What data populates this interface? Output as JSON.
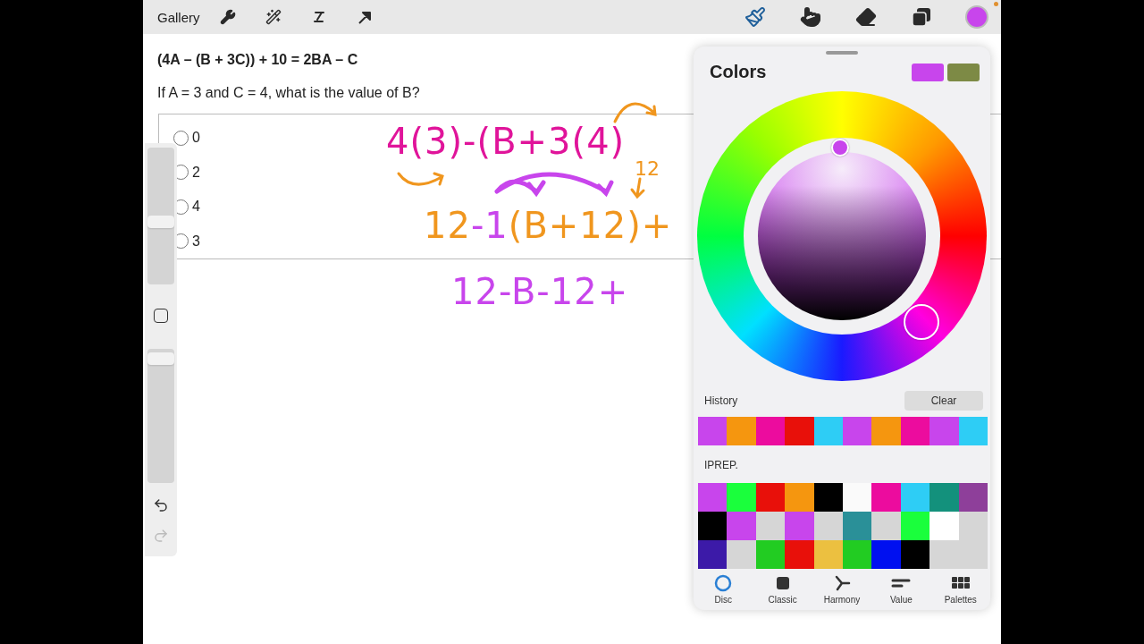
{
  "toolbar": {
    "gallery": "Gallery",
    "tools": [
      {
        "kind": "brush",
        "selected": true
      },
      {
        "kind": "smudge",
        "selected": false
      },
      {
        "kind": "eraser",
        "selected": false
      },
      {
        "kind": "layers",
        "selected": false
      }
    ]
  },
  "document": {
    "formula": "(4A – (B + 3C)) + 10 = 2BA – C",
    "question": "If A = 3 and C = 4, what is the value of B?",
    "options": [
      {
        "label": "0",
        "selected": false
      },
      {
        "label": "2",
        "selected": false
      },
      {
        "label": "4",
        "selected": false
      },
      {
        "label": "3",
        "selected": false
      }
    ]
  },
  "handwriting": [
    {
      "segments": [
        {
          "text": "4(3)-(B+3(4)",
          "color": "#e0149a"
        }
      ]
    },
    {
      "segments": [
        {
          "text": "12",
          "color": "#f0961e"
        },
        {
          "text": "-1",
          "color": "#c845ec"
        },
        {
          "text": "(B+12)+",
          "color": "#f0961e"
        }
      ]
    },
    {
      "segments": [
        {
          "text": "12-B-12+",
          "color": "#c845ec"
        }
      ]
    }
  ],
  "note": {
    "text": "12",
    "color": "#f0961e"
  },
  "sidebar": {
    "size": {
      "level": 0.45
    },
    "opacity": {
      "level": 0.97
    }
  },
  "colors_panel": {
    "title": "Colors",
    "history_label": "History",
    "clear": "Clear",
    "history": [
      {
        "color": "#c845ec"
      },
      {
        "color": "#f5960f"
      },
      {
        "color": "#ec0c9e"
      },
      {
        "color": "#e8100a"
      },
      {
        "color": "#2ecdf5"
      },
      {
        "color": "#c845ec"
      },
      {
        "color": "#f5960f"
      },
      {
        "color": "#ec0c9e"
      },
      {
        "color": "#c845ec"
      },
      {
        "color": "#2ecdf5"
      }
    ],
    "palette_name": "IPREP.",
    "palette": [
      {
        "color": "#c845ec"
      },
      {
        "color": "#1aff3c"
      },
      {
        "color": "#e8100a"
      },
      {
        "color": "#f5960f"
      },
      {
        "color": "#000000"
      },
      {
        "kind": "empty"
      },
      {
        "color": "#ec0c9e"
      },
      {
        "color": "#2ecdf5"
      },
      {
        "color": "#13917c"
      },
      {
        "color": "#8e3f9a"
      },
      {
        "color": "#000000"
      },
      {
        "color": "#c845ec"
      },
      {
        "color": "#d6d6d6"
      },
      {
        "color": "#c845ec"
      },
      {
        "color": "#d6d6d6"
      },
      {
        "color": "#2a9098"
      },
      {
        "color": "#d6d6d6"
      },
      {
        "color": "#1aff3c"
      },
      {
        "color": "#ffffff"
      },
      {
        "color": "#d6d6d6"
      },
      {
        "color": "#3c1aa8"
      },
      {
        "color": "#d6d6d6"
      },
      {
        "color": "#22cc22"
      },
      {
        "color": "#e8100a"
      },
      {
        "color": "#ecc040"
      },
      {
        "color": "#22cc22"
      },
      {
        "color": "#0010f0"
      },
      {
        "color": "#000000"
      },
      {
        "color": "#d6d6d6"
      },
      {
        "color": "#d6d6d6"
      }
    ],
    "tabs": [
      {
        "kind": "disc",
        "label": "Disc",
        "selected": true
      },
      {
        "kind": "classic",
        "label": "Classic",
        "selected": false
      },
      {
        "kind": "harmony",
        "label": "Harmony",
        "selected": false
      },
      {
        "kind": "value",
        "label": "Value",
        "selected": false
      },
      {
        "kind": "palettes",
        "label": "Palettes",
        "selected": false
      }
    ]
  }
}
